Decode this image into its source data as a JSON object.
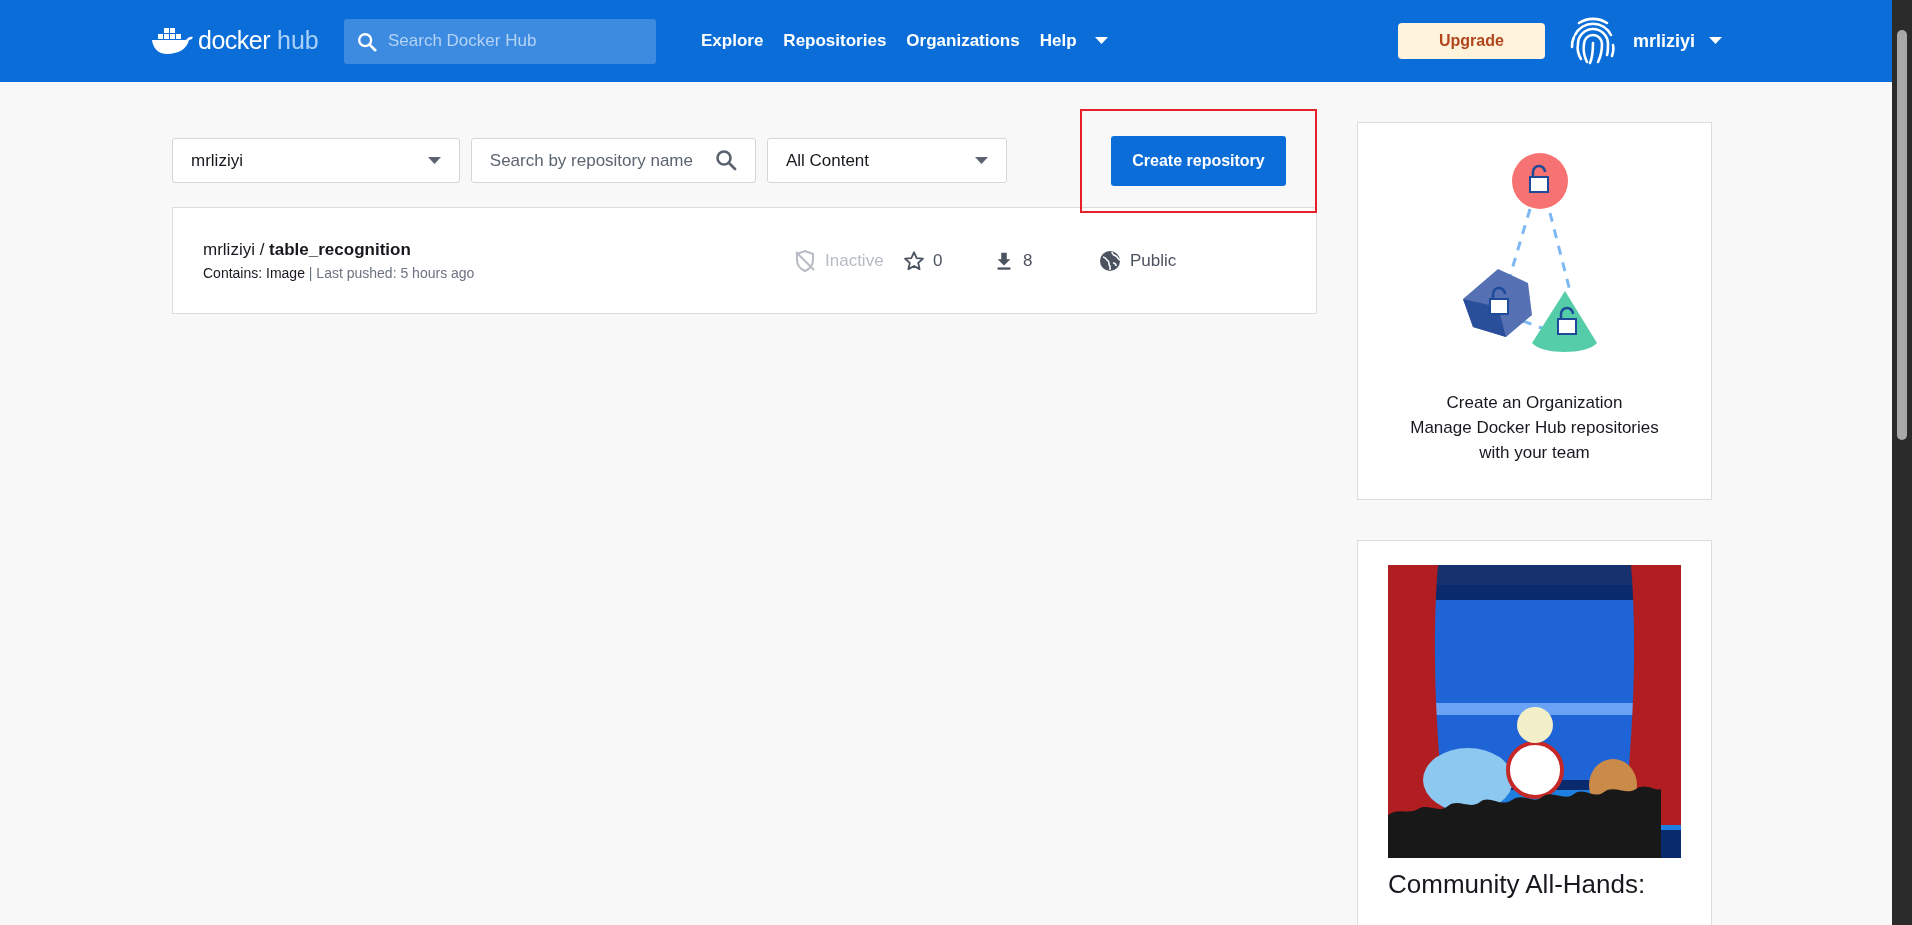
{
  "navbar": {
    "logo": {
      "word1": "docker",
      "word2": "hub"
    },
    "search": {
      "placeholder": "Search Docker Hub"
    },
    "links": [
      {
        "label": "Explore",
        "dropdown": false
      },
      {
        "label": "Repositories",
        "dropdown": false
      },
      {
        "label": "Organizations",
        "dropdown": false
      },
      {
        "label": "Help",
        "dropdown": true
      }
    ],
    "upgrade": "Upgrade",
    "user": "mrliziyi"
  },
  "filters": {
    "namespace": "mrliziyi",
    "search": {
      "placeholder": "Search by repository name"
    },
    "content": "All Content"
  },
  "create_button": {
    "label": "Create repository",
    "highlighted": true
  },
  "repositories": [
    {
      "namespace": "mrliziyi",
      "separator": "/",
      "name": "table_recognition",
      "contains": "Contains: Image",
      "pushed": "| Last pushed: 5 hours ago",
      "status": "Inactive",
      "active": false,
      "star_count": "0",
      "pulls": "8",
      "visibility": "Public"
    }
  ],
  "org_card": {
    "lines": [
      "Create an Organization",
      "Manage Docker Hub repositories",
      "with your team"
    ]
  },
  "promo_card": {
    "title": "Community All-Hands:"
  }
}
